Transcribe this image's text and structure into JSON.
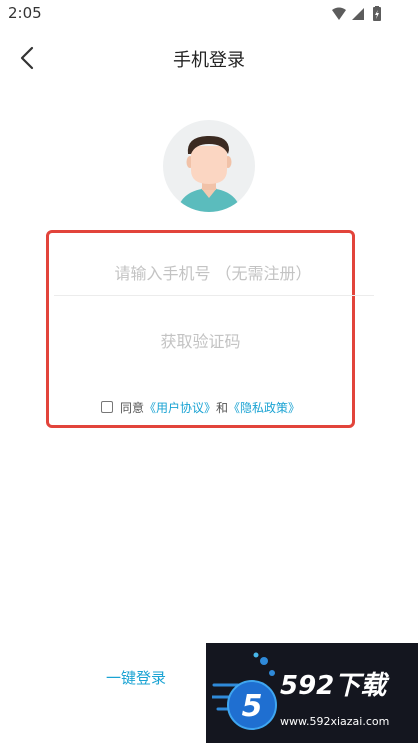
{
  "status_bar": {
    "time": "2:05",
    "icons": [
      "wifi-icon",
      "signal-icon",
      "battery-charging-icon"
    ]
  },
  "header": {
    "title": "手机登录",
    "back_icon": "chevron-left-icon"
  },
  "avatar": {
    "icon": "default-user-avatar"
  },
  "form": {
    "phone_placeholder": "请输入手机号 （无需注册）",
    "phone_value": "",
    "code_button_label": "获取验证码",
    "agreement": {
      "prefix": "同意",
      "user_agreement": "《用户协议》",
      "conjunction": "和",
      "privacy_policy": "《隐私政策》",
      "checked": false
    }
  },
  "footer": {
    "one_key_login": "一键登录"
  },
  "watermark": {
    "logo_digit": "5",
    "brand": "592下载",
    "url": "www.592xiazai.com"
  },
  "colors": {
    "accent": "#1aa3d3",
    "highlight_border": "#e2443b",
    "placeholder": "#c3c3c3",
    "title": "#222222"
  }
}
